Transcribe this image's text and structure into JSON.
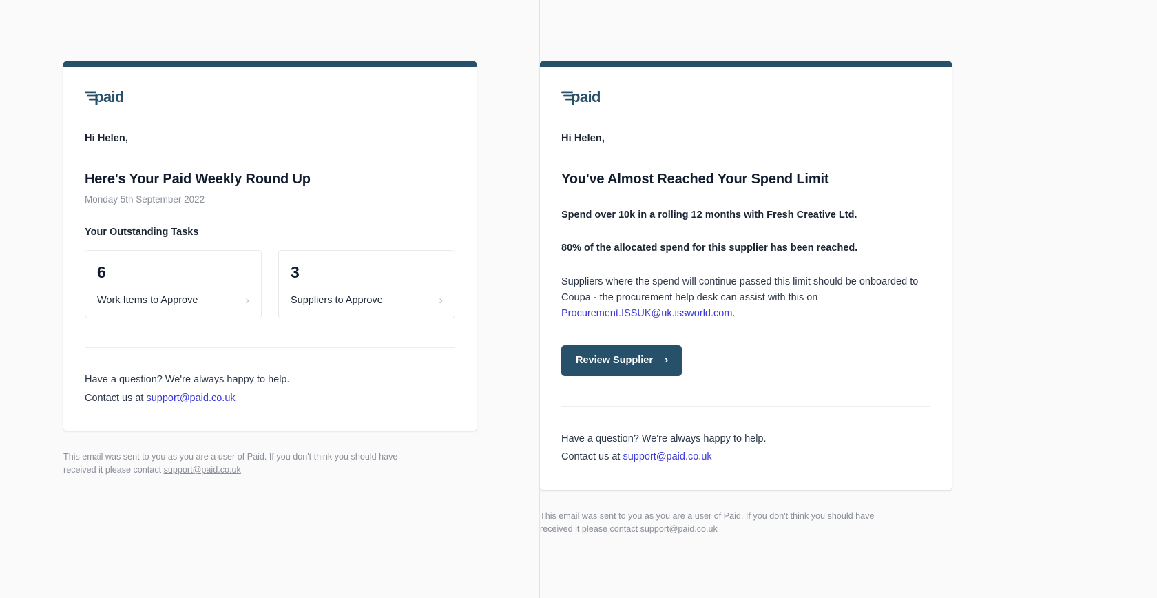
{
  "brand": {
    "logo_text": "paid",
    "logo_name": "paid-logo",
    "accent_color": "#27506a",
    "link_color": "#3b39d6",
    "muted_color": "#8a8f99"
  },
  "emails": [
    {
      "id": "weekly-round-up",
      "greeting": "Hi Helen,",
      "headline": "Here's Your Paid Weekly Round Up",
      "date": "Monday 5th September 2022",
      "section_title": "Your Outstanding Tasks",
      "stats": [
        {
          "value": "6",
          "label": "Work Items to Approve",
          "chevron": "›"
        },
        {
          "value": "3",
          "label": "Suppliers to Approve",
          "chevron": "›"
        }
      ],
      "help_question": "Have a question? We're always happy to help.",
      "help_contact_prefix": "Contact us at ",
      "help_email": "support@paid.co.uk",
      "disclaimer_prefix": "This email was sent to you as you are a user of Paid. If you don't think you should have received it please contact ",
      "disclaimer_email": "support@paid.co.uk"
    },
    {
      "id": "spend-limit-alert",
      "greeting": "Hi Helen,",
      "headline": "You've Almost Reached Your Spend Limit",
      "bold_para_1": "Spend over 10k in a rolling 12 months with Fresh Creative Ltd.",
      "bold_para_2": "80% of the allocated spend for this supplier has been reached.",
      "body_para_prefix": "Suppliers where the spend will continue passed this limit should be onboarded to Coupa - the procurement help desk can assist with this on ",
      "body_para_email": "Procurement.ISSUK@uk.issworld.com",
      "body_para_suffix": ".",
      "button_label": "Review Supplier",
      "button_chevron": "›",
      "help_question": "Have a question? We're always happy to help.",
      "help_contact_prefix": "Contact us at ",
      "help_email": "support@paid.co.uk",
      "disclaimer_prefix": "This email was sent to you as you are a user of Paid. If you don't think you should have received it please contact ",
      "disclaimer_email": "support@paid.co.uk"
    }
  ]
}
